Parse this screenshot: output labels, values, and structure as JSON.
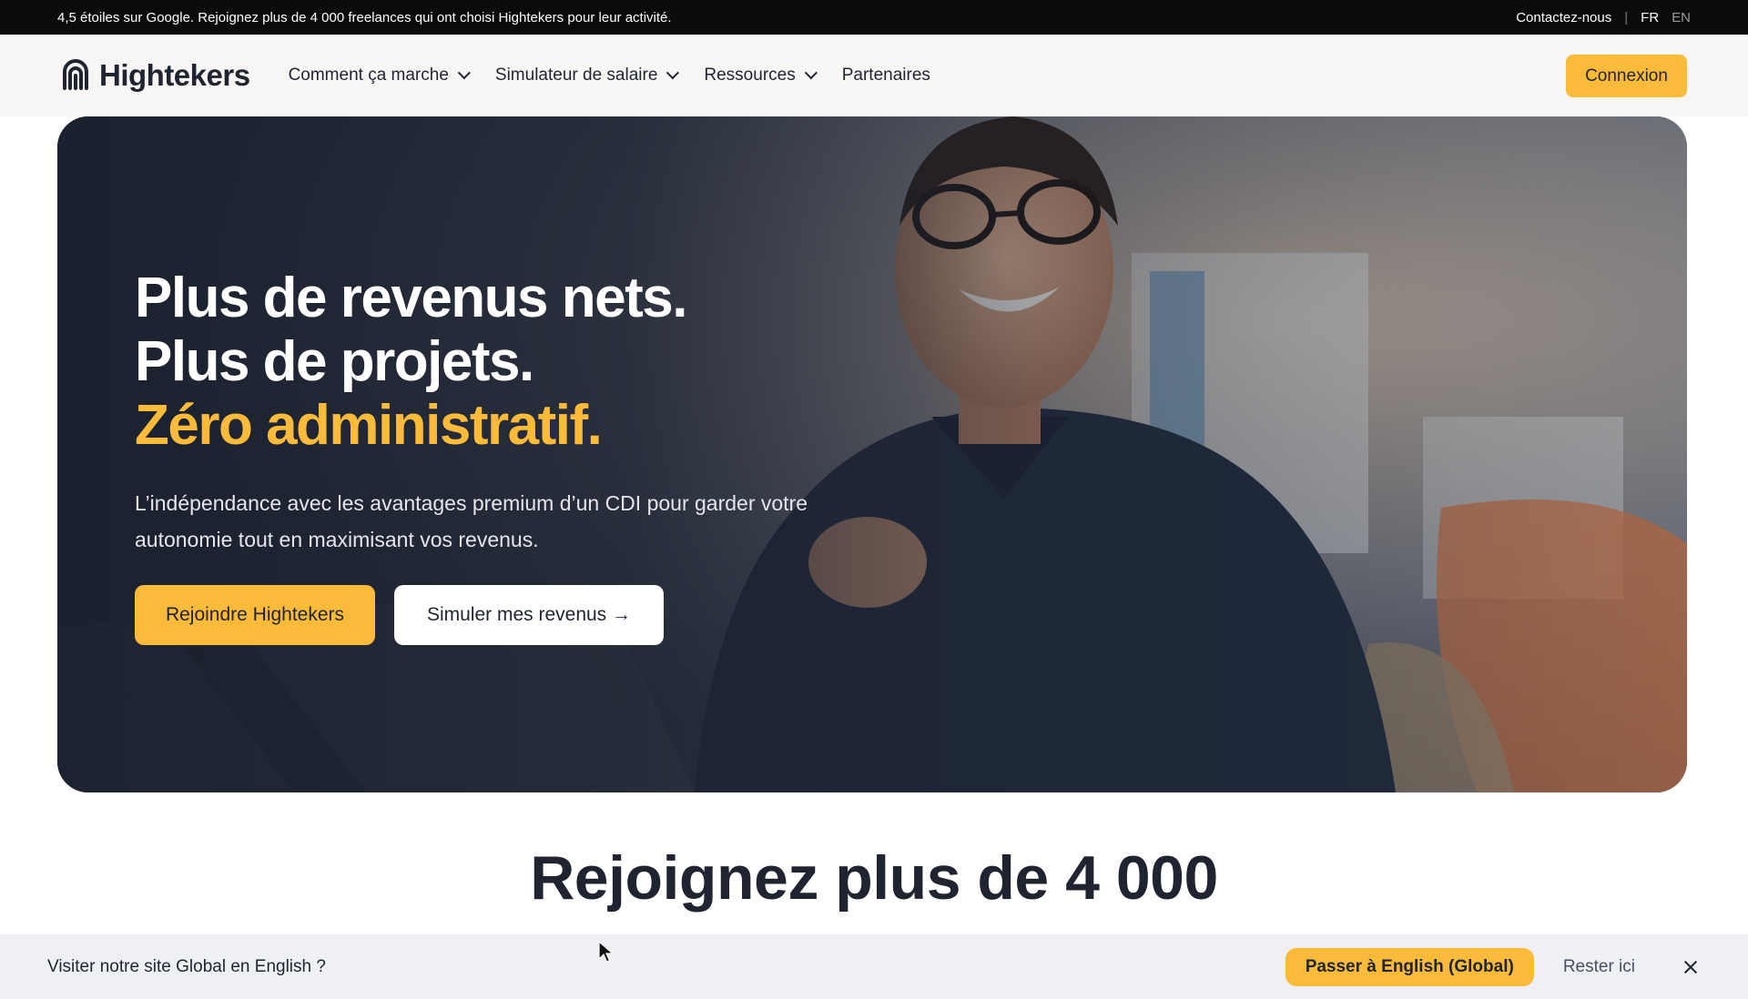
{
  "topbar": {
    "announcement": "4,5 étoiles sur Google. Rejoignez plus de 4 000 freelances qui ont choisi Hightekers pour leur activité.",
    "contact": "Contactez-nous",
    "separator": "|",
    "lang_fr": "FR",
    "lang_en": "EN"
  },
  "header": {
    "logo_text": "Hightekers",
    "nav": [
      {
        "label": "Comment ça marche",
        "icon": "chevron-down-icon"
      },
      {
        "label": "Simulateur de salaire",
        "icon": "chevron-down-icon"
      },
      {
        "label": "Ressources",
        "icon": "chevron-down-icon"
      },
      {
        "label": "Partenaires"
      }
    ],
    "login_label": "Connexion"
  },
  "hero": {
    "title_line1": "Plus de revenus nets.",
    "title_line2": "Plus de projets.",
    "title_line3": "Zéro administratif.",
    "subtitle": "L’indépendance avec les avantages premium d’un CDI pour garder votre autonomie tout en maximisant vos revenus.",
    "primary_button": "Rejoindre Hightekers",
    "secondary_button": "Simuler mes revenus →"
  },
  "section": {
    "title": "Rejoignez plus de 4 000"
  },
  "banner": {
    "text": "Visiter notre site Global en English ?",
    "switch_button": "Passer à English (Global)",
    "stay_button": "Rester ici",
    "close_icon": "close-icon"
  },
  "colors": {
    "accent": "#fbbb3a",
    "dark": "#0b0b0d",
    "text": "#1f2430",
    "header_bg": "#f7f6f4",
    "banner_bg": "#eef0f3"
  }
}
